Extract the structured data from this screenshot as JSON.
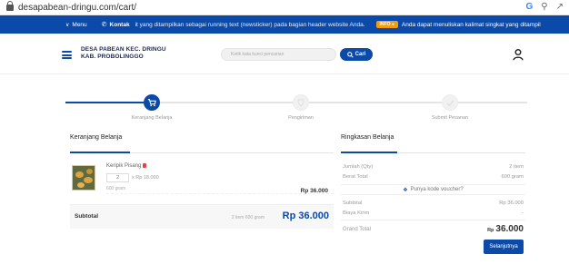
{
  "browser": {
    "url": "desapabean-dringu.com/cart/"
  },
  "topbar": {
    "menu_label": "Menu",
    "kontak_label": "Kontak",
    "running_text": "it yang ditampilkan sebagai running text (newsticker) pada bagian header website Anda.",
    "badge": "INFO ●",
    "running_text2": "Anda dapat menuliskan kalimat singkat yang ditampil"
  },
  "header": {
    "brand_line1": "DESA PABEAN KEC. DRINGU",
    "brand_line2": "KAB. PROBOLINGGO",
    "search_placeholder": "Ketik kata kunci pencarian",
    "search_button": "Cari"
  },
  "steps": [
    {
      "label": "Keranjang Belanja",
      "active": true
    },
    {
      "label": "Pengiriman",
      "active": false
    },
    {
      "label": "Submit Pesanan",
      "active": false
    }
  ],
  "cart": {
    "title": "Keranjang Belanja",
    "items": [
      {
        "name": "Keripik Pisang",
        "qty": "2",
        "unit_price": "x Rp 18.000",
        "weight": "600 gram",
        "total": "Rp 36.000"
      }
    ],
    "subtotal_label": "Subtotal",
    "subtotal_meta": "2 item 600 gram",
    "subtotal_value": "Rp 36.000"
  },
  "summary": {
    "title": "Ringkasan Belanja",
    "jumlah_label": "Jumlah (Qty)",
    "jumlah_value": "2 item",
    "berat_label": "Berat Total",
    "berat_value": "600 gram",
    "voucher_label": "Punya kode voucher?",
    "subtotal_label": "Subtotal",
    "subtotal_value": "Rp 36.000",
    "ongkir_label": "Biaya Kirim",
    "ongkir_value": "-",
    "grand_label": "Grand Total",
    "grand_currency": "Rp",
    "grand_value": "36.000",
    "next_button": "Selanjutnya"
  },
  "colors": {
    "primary": "#0b4aa8",
    "accent": "#f39c12"
  }
}
